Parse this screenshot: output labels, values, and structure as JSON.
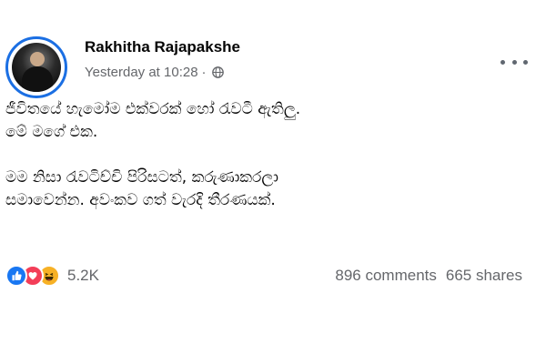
{
  "post": {
    "author": "Rakhitha Rajapakshe",
    "timestamp": "Yesterday at 10:28",
    "separator": "·",
    "privacy_icon": "globe-icon",
    "more_icon": "more-options-icon",
    "paragraphs": [
      {
        "lines": [
          "ජීවිතයේ හැමෝම එක්වරක් හෝ රැවටී ඇතිලු.",
          "මේ මගේ එක."
        ]
      },
      {
        "lines": [
          "මම නිසා රැවටිච්චි පිරිසටත්, කරුණාකරලා",
          "සමාවෙන්න. අවංකව ගත් වැරදි තීරණයක්."
        ]
      }
    ]
  },
  "stats": {
    "reactions_count": "5.2K",
    "reaction_icons": [
      "like-icon",
      "love-icon",
      "haha-icon"
    ],
    "comments": "896 comments",
    "shares": "665 shares"
  },
  "colors": {
    "like": "#1877f2",
    "love": "#f33e58",
    "haha": "#f7b125",
    "avatar_ring": "#1b6fe3",
    "secondary_text": "#65676b"
  }
}
